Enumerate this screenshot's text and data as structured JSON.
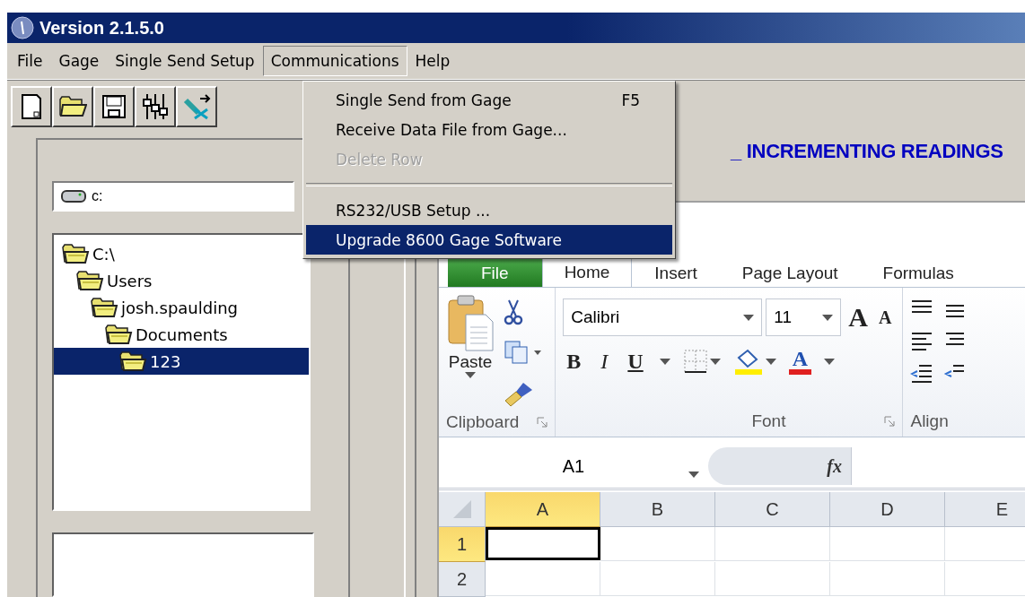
{
  "window": {
    "title": "Version 2.1.5.0"
  },
  "menu_bar": [
    {
      "label": "File",
      "selected": false
    },
    {
      "label": "Gage",
      "selected": false
    },
    {
      "label": "Single Send Setup",
      "selected": false
    },
    {
      "label": "Communications",
      "selected": true
    },
    {
      "label": "Help",
      "selected": false
    }
  ],
  "open_menu": [
    {
      "kind": "item",
      "label": "Single Send from Gage",
      "shortcut": "F5",
      "disabled": false,
      "selected": false
    },
    {
      "kind": "item",
      "label": "Receive Data File from Gage...",
      "disabled": false,
      "selected": false
    },
    {
      "kind": "item",
      "label": "Delete Row",
      "disabled": true,
      "selected": false
    },
    {
      "kind": "separator"
    },
    {
      "kind": "item",
      "label": "RS232/USB Setup ...",
      "disabled": false,
      "selected": false
    },
    {
      "kind": "item",
      "label": "Upgrade 8600 Gage Software",
      "disabled": false,
      "selected": true
    }
  ],
  "drive_selector": {
    "value": "c:"
  },
  "folder_tree": [
    {
      "label": "C:\\",
      "selected": false,
      "children": [
        {
          "label": "Users",
          "selected": false,
          "children": [
            {
              "label": "josh.spaulding",
              "selected": false,
              "children": [
                {
                  "label": "Documents",
                  "selected": false,
                  "children": [
                    {
                      "label": "123",
                      "selected": true
                    }
                  ]
                }
              ]
            }
          ]
        }
      ]
    }
  ],
  "heading": "_ INCREMENTING READINGS",
  "ribbon_tabs": [
    {
      "kind": "file",
      "label": "File",
      "selected": false
    },
    {
      "kind": "tab",
      "label": "Home",
      "selected": true
    },
    {
      "kind": "tab",
      "label": "Insert",
      "selected": false
    },
    {
      "kind": "tab",
      "label": "Page Layout",
      "selected": false
    },
    {
      "kind": "tab",
      "label": "Formulas",
      "selected": false
    }
  ],
  "clipboard_group": {
    "paste_label": "Paste",
    "label": "Clipboard"
  },
  "font_group": {
    "font_name": "Calibri",
    "font_size": "11",
    "grow_glyph": "A",
    "shrink_glyph": "A",
    "bold_glyph": "B",
    "italic_glyph": "I",
    "underline_glyph": "U",
    "font_color_glyph": "A",
    "label": "Font"
  },
  "alignment_group": {
    "label": "Align"
  },
  "formula_bar": {
    "name_box": "A1",
    "function_glyph": "fx"
  },
  "columns": [
    {
      "label": "A",
      "selected": true
    },
    {
      "label": "B",
      "selected": false
    },
    {
      "label": "C",
      "selected": false
    },
    {
      "label": "D",
      "selected": false
    },
    {
      "label": "E",
      "selected": false
    }
  ],
  "rows": [
    {
      "label": "1",
      "selected": true
    },
    {
      "label": "2",
      "selected": false
    }
  ]
}
